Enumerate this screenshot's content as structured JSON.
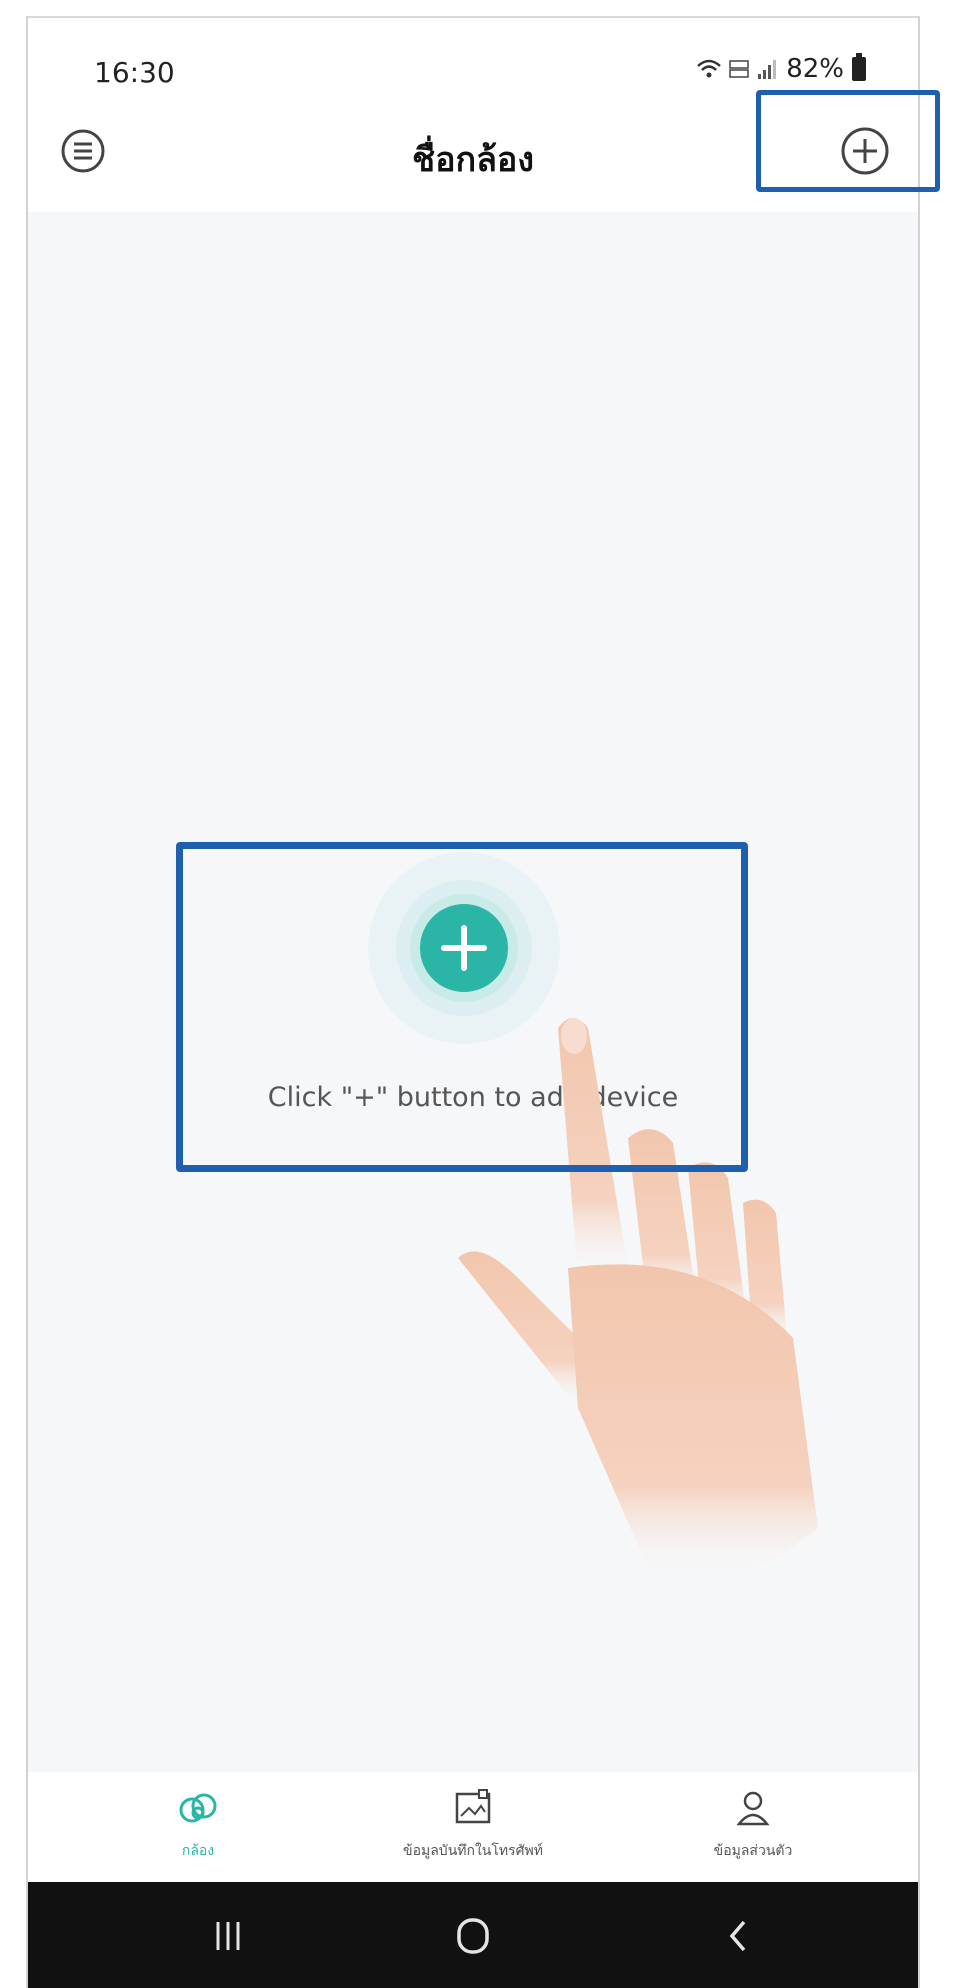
{
  "status_bar": {
    "time": "16:30",
    "battery": "82%",
    "signal_icons": [
      "wifi-icon",
      "volte-icon",
      "signal-icon",
      "battery-icon"
    ]
  },
  "header": {
    "title": "ชื่อกล้อง",
    "menu_icon": "menu-list-icon",
    "add_icon": "plus-circle-icon"
  },
  "main": {
    "empty_state_hint": "Click \"+\" button to add device",
    "add_button_icon": "plus-icon",
    "accent_color": "#2bb5a6"
  },
  "tabs": [
    {
      "label": "กล้อง",
      "icon": "camera-cloud-icon",
      "active": true
    },
    {
      "label": "ข้อมูลบันทึกในโทรศัพท์",
      "icon": "gallery-icon",
      "active": false
    },
    {
      "label": "ข้อมูลส่วนตัว",
      "icon": "user-icon",
      "active": false
    }
  ],
  "system_nav": {
    "recent_icon": "recent-apps-icon",
    "home_icon": "home-icon",
    "back_icon": "back-icon"
  },
  "annotations": {
    "highlight_color": "#1f5fb0"
  }
}
